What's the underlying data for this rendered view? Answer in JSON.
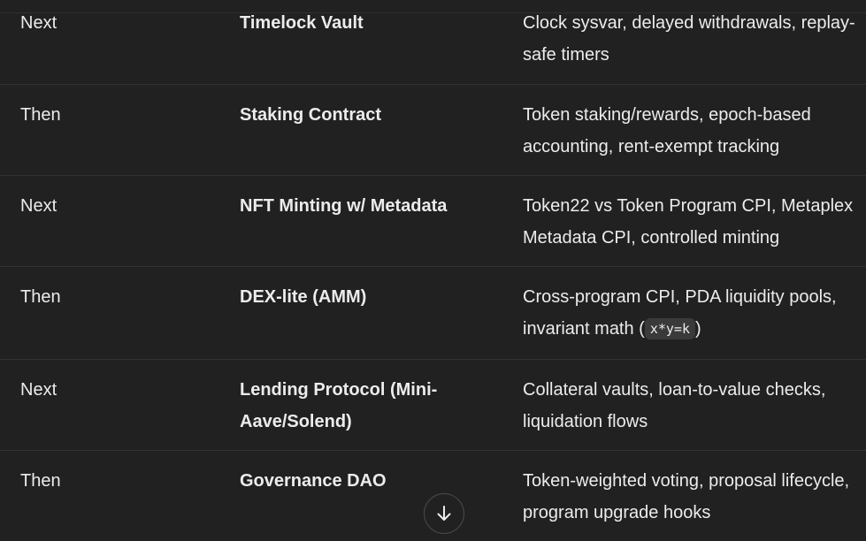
{
  "rows": [
    {
      "phase": "Next",
      "project": "Timelock Vault",
      "focus": "Clock sysvar, delayed withdrawals, replay-safe timers"
    },
    {
      "phase": "Then",
      "project": "Staking Contract",
      "focus": "Token staking/rewards, epoch-based accounting, rent-exempt tracking"
    },
    {
      "phase": "Next",
      "project": "NFT Minting w/ Metadata",
      "focus": "Token22 vs Token Program CPI, Metaplex Metadata CPI, controlled minting"
    },
    {
      "phase": "Then",
      "project": "DEX-lite (AMM)",
      "focus_before": "Cross-program CPI, PDA liquidity pools, invariant math (",
      "focus_code": "x*y=k",
      "focus_after": ")"
    },
    {
      "phase": "Next",
      "project": "Lending Protocol (Mini-Aave/Solend)",
      "focus": "Collateral vaults, loan-to-value checks, liquidation flows"
    },
    {
      "phase": "Then",
      "project": "Governance DAO",
      "focus": "Token-weighted voting, proposal lifecycle, program upgrade hooks"
    }
  ],
  "scroll_button": {
    "icon": "arrow-down-icon"
  }
}
